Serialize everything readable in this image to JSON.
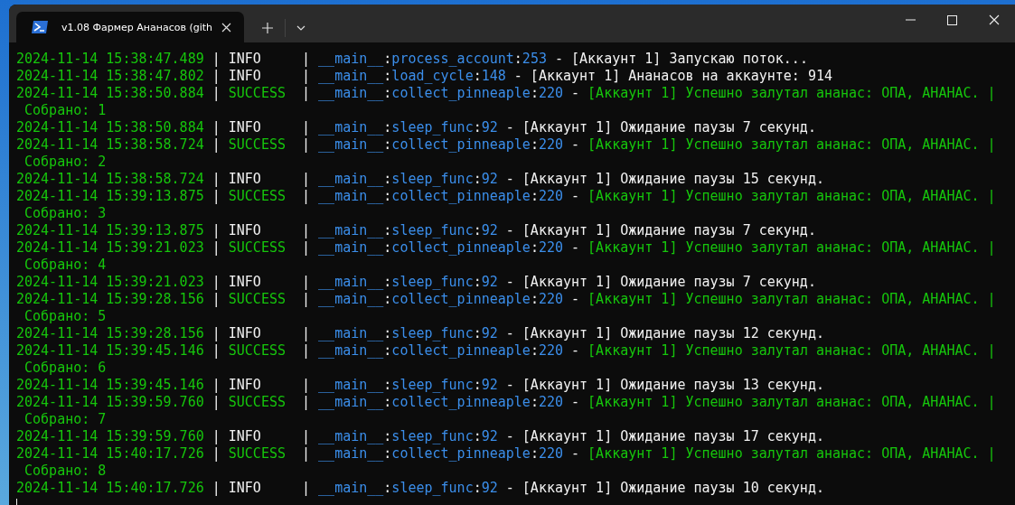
{
  "window": {
    "tab_title": "v1.08 Фармер Ананасов (gith"
  },
  "log": [
    {
      "kind": "info",
      "time": "2024-11-14 15:38:47.489",
      "separators": [
        "|",
        "|",
        "-"
      ],
      "level": "INFO",
      "source": "__main__:process_account:253",
      "message": "[Аккаунт 1] Запускаю поток..."
    },
    {
      "kind": "info",
      "time": "2024-11-14 15:38:47.802",
      "separators": [
        "|",
        "|",
        "-"
      ],
      "level": "INFO",
      "source": "__main__:load_cycle:148",
      "message": "[Аккаунт 1] Ананасов на аккаунте: 914"
    },
    {
      "kind": "success",
      "time": "2024-11-14 15:38:50.884",
      "separators": [
        "|",
        "|",
        "-"
      ],
      "level": "SUCCESS",
      "source": "__main__:collect_pinneaple:220",
      "message": "[Аккаунт 1] Успешно залутал ананас: ОПА, АНАНАС. |",
      "continuation": "Собрано: 1"
    },
    {
      "kind": "info",
      "time": "2024-11-14 15:38:50.884",
      "separators": [
        "|",
        "|",
        "-"
      ],
      "level": "INFO",
      "source": "__main__:sleep_func:92",
      "message": "[Аккаунт 1] Ожидание паузы 7 секунд."
    },
    {
      "kind": "success",
      "time": "2024-11-14 15:38:58.724",
      "separators": [
        "|",
        "|",
        "-"
      ],
      "level": "SUCCESS",
      "source": "__main__:collect_pinneaple:220",
      "message": "[Аккаунт 1] Успешно залутал ананас: ОПА, АНАНАС. |",
      "continuation": "Собрано: 2"
    },
    {
      "kind": "info",
      "time": "2024-11-14 15:38:58.724",
      "separators": [
        "|",
        "|",
        "-"
      ],
      "level": "INFO",
      "source": "__main__:sleep_func:92",
      "message": "[Аккаунт 1] Ожидание паузы 15 секунд."
    },
    {
      "kind": "success",
      "time": "2024-11-14 15:39:13.875",
      "separators": [
        "|",
        "|",
        "-"
      ],
      "level": "SUCCESS",
      "source": "__main__:collect_pinneaple:220",
      "message": "[Аккаунт 1] Успешно залутал ананас: ОПА, АНАНАС. |",
      "continuation": "Собрано: 3"
    },
    {
      "kind": "info",
      "time": "2024-11-14 15:39:13.875",
      "separators": [
        "|",
        "|",
        "-"
      ],
      "level": "INFO",
      "source": "__main__:sleep_func:92",
      "message": "[Аккаунт 1] Ожидание паузы 7 секунд."
    },
    {
      "kind": "success",
      "time": "2024-11-14 15:39:21.023",
      "separators": [
        "|",
        "|",
        "-"
      ],
      "level": "SUCCESS",
      "source": "__main__:collect_pinneaple:220",
      "message": "[Аккаунт 1] Успешно залутал ананас: ОПА, АНАНАС. |",
      "continuation": "Собрано: 4"
    },
    {
      "kind": "info",
      "time": "2024-11-14 15:39:21.023",
      "separators": [
        "|",
        "|",
        "-"
      ],
      "level": "INFO",
      "source": "__main__:sleep_func:92",
      "message": "[Аккаунт 1] Ожидание паузы 7 секунд."
    },
    {
      "kind": "success",
      "time": "2024-11-14 15:39:28.156",
      "separators": [
        "|",
        "|",
        "-"
      ],
      "level": "SUCCESS",
      "source": "__main__:collect_pinneaple:220",
      "message": "[Аккаунт 1] Успешно залутал ананас: ОПА, АНАНАС. |",
      "continuation": "Собрано: 5"
    },
    {
      "kind": "info",
      "time": "2024-11-14 15:39:28.156",
      "separators": [
        "|",
        "|",
        "-"
      ],
      "level": "INFO",
      "source": "__main__:sleep_func:92",
      "message": "[Аккаунт 1] Ожидание паузы 12 секунд."
    },
    {
      "kind": "success",
      "time": "2024-11-14 15:39:45.146",
      "separators": [
        "|",
        "|",
        "-"
      ],
      "level": "SUCCESS",
      "source": "__main__:collect_pinneaple:220",
      "message": "[Аккаунт 1] Успешно залутал ананас: ОПА, АНАНАС. |",
      "continuation": "Собрано: 6"
    },
    {
      "kind": "info",
      "time": "2024-11-14 15:39:45.146",
      "separators": [
        "|",
        "|",
        "-"
      ],
      "level": "INFO",
      "source": "__main__:sleep_func:92",
      "message": "[Аккаунт 1] Ожидание паузы 13 секунд."
    },
    {
      "kind": "success",
      "time": "2024-11-14 15:39:59.760",
      "separators": [
        "|",
        "|",
        "-"
      ],
      "level": "SUCCESS",
      "source": "__main__:collect_pinneaple:220",
      "message": "[Аккаунт 1] Успешно залутал ананас: ОПА, АНАНАС. |",
      "continuation": "Собрано: 7"
    },
    {
      "kind": "info",
      "time": "2024-11-14 15:39:59.760",
      "separators": [
        "|",
        "|",
        "-"
      ],
      "level": "INFO",
      "source": "__main__:sleep_func:92",
      "message": "[Аккаунт 1] Ожидание паузы 17 секунд."
    },
    {
      "kind": "success",
      "time": "2024-11-14 15:40:17.726",
      "separators": [
        "|",
        "|",
        "-"
      ],
      "level": "SUCCESS",
      "source": "__main__:collect_pinneaple:220",
      "message": "[Аккаунт 1] Успешно залутал ананас: ОПА, АНАНАС. |",
      "continuation": "Собрано: 8"
    },
    {
      "kind": "info",
      "time": "2024-11-14 15:40:17.726",
      "separators": [
        "|",
        "|",
        "-"
      ],
      "level": "INFO",
      "source": "__main__:sleep_func:92",
      "message": "[Аккаунт 1] Ожидание паузы 10 секунд."
    }
  ]
}
